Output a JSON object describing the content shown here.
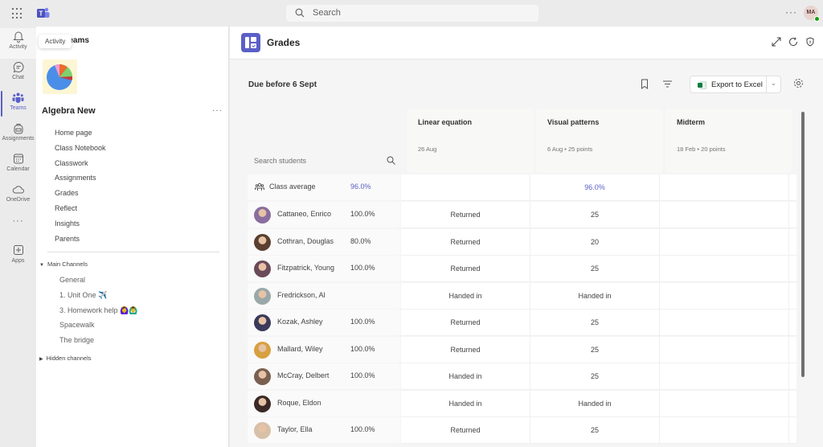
{
  "topbar": {
    "search_placeholder": "Search",
    "more_label": "···",
    "user_initials": "MA"
  },
  "rail": {
    "items": [
      {
        "label": "Activity",
        "icon": "bell-icon"
      },
      {
        "label": "Chat",
        "icon": "chat-icon"
      },
      {
        "label": "Teams",
        "icon": "teams-icon",
        "active": true
      },
      {
        "label": "Assignments",
        "icon": "backpack-icon"
      },
      {
        "label": "Calendar",
        "icon": "calendar-icon"
      },
      {
        "label": "OneDrive",
        "icon": "cloud-icon"
      },
      {
        "label": "···",
        "icon": "more-icon"
      },
      {
        "label": "Apps",
        "icon": "add-app-icon"
      }
    ],
    "tooltip": "Activity"
  },
  "team_panel": {
    "heading": "Teams",
    "team_name": "Algebra New",
    "more_label": "···",
    "nav": [
      "Home page",
      "Class Notebook",
      "Classwork",
      "Assignments",
      "Grades",
      "Reflect",
      "Insights",
      "Parents"
    ],
    "main_channels_label": "Main Channels",
    "channels": [
      "General",
      "1. Unit One ✈️",
      "3. Homework help 🙆‍♀️🙆‍♂️",
      "Spacewalk",
      "The bridge"
    ],
    "hidden_channels_label": "Hidden channels"
  },
  "app": {
    "title": "Grades",
    "due_label": "Due before 6 Sept",
    "export_label": "Export to Excel",
    "search_students_placeholder": "Search students"
  },
  "columns": [
    {
      "title": "Linear equation",
      "subtitle": "26 Aug"
    },
    {
      "title": "Visual patterns",
      "subtitle": "6 Aug • 25 points"
    },
    {
      "title": "Midterm",
      "subtitle": "18 Feb • 20 points"
    }
  ],
  "class_average": {
    "label": "Class average",
    "value": "96.0%",
    "cells": [
      "",
      "96.0%",
      ""
    ]
  },
  "students": [
    {
      "name": "Cattaneo, Enrico",
      "pct": "100.0%",
      "cells": [
        "Returned",
        "25",
        ""
      ],
      "avatar_color": "#8a6e9e"
    },
    {
      "name": "Cothran, Douglas",
      "pct": "80.0%",
      "cells": [
        "Returned",
        "20",
        ""
      ],
      "avatar_color": "#5a4030"
    },
    {
      "name": "Fitzpatrick, Young",
      "pct": "100.0%",
      "cells": [
        "Returned",
        "25",
        ""
      ],
      "avatar_color": "#6b4a5a"
    },
    {
      "name": "Fredrickson, Al",
      "pct": "",
      "cells": [
        "Handed in",
        "Handed in",
        ""
      ],
      "avatar_color": "#9aa8a8"
    },
    {
      "name": "Kozak, Ashley",
      "pct": "100.0%",
      "cells": [
        "Returned",
        "25",
        ""
      ],
      "avatar_color": "#3a3a5a"
    },
    {
      "name": "Mallard, Wiley",
      "pct": "100.0%",
      "cells": [
        "Returned",
        "25",
        ""
      ],
      "avatar_color": "#d8a040"
    },
    {
      "name": "McCray, Delbert",
      "pct": "100.0%",
      "cells": [
        "Handed in",
        "25",
        ""
      ],
      "avatar_color": "#7a6050"
    },
    {
      "name": "Roque, Eldon",
      "pct": "",
      "cells": [
        "Handed in",
        "Handed in",
        ""
      ],
      "avatar_color": "#3a2a25"
    },
    {
      "name": "Taylor, Ella",
      "pct": "100.0%",
      "cells": [
        "Returned",
        "25",
        ""
      ],
      "avatar_color": "#d8c0a8"
    }
  ],
  "colors": {
    "accent": "#5b5fc7",
    "presence": "#13a10e",
    "excel": "#107c41"
  }
}
